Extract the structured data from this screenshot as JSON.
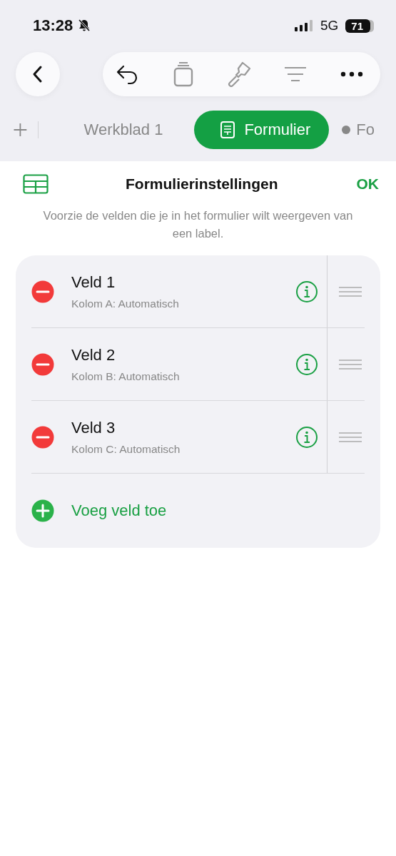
{
  "status_bar": {
    "time": "13:28",
    "network": "5G",
    "battery": "71",
    "silent": true
  },
  "tabs": [
    {
      "label": "Werkblad 1",
      "selected": false,
      "kind": "sheet"
    },
    {
      "label": "Formulier",
      "selected": true,
      "kind": "form"
    },
    {
      "label": "Fo",
      "selected": false,
      "kind": "dot"
    }
  ],
  "header": {
    "title": "Formulierinstellingen",
    "done": "OK",
    "description": "Voorzie de velden die je in het formulier wilt weergeven van een label."
  },
  "fields": [
    {
      "name": "Veld 1",
      "detail": "Kolom A: Automatisch"
    },
    {
      "name": "Veld 2",
      "detail": "Kolom B: Automatisch"
    },
    {
      "name": "Veld 3",
      "detail": "Kolom C: Automatisch"
    }
  ],
  "add_field": "Voeg veld toe"
}
